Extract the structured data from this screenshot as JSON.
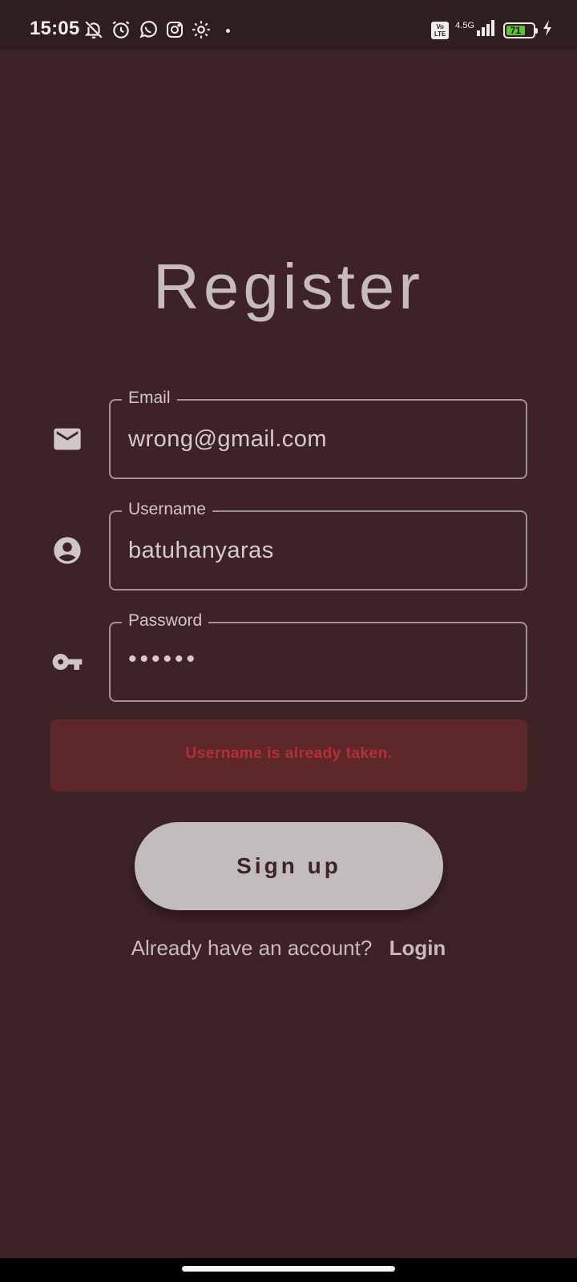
{
  "status_bar": {
    "time": "15:05",
    "network": "4.5G",
    "volte": "Vo LTE",
    "battery": "71"
  },
  "title": "Register",
  "fields": {
    "email": {
      "label": "Email",
      "value": "wrong@gmail.com"
    },
    "username": {
      "label": "Username",
      "value": "batuhanyaras"
    },
    "password": {
      "label": "Password",
      "value": "••••••"
    }
  },
  "error": {
    "message": "Username is already taken."
  },
  "signup_button": {
    "label": "Sign up"
  },
  "login": {
    "prompt": "Already have an account?",
    "link": "Login"
  },
  "colors": {
    "background": "#3e2326",
    "status_bar": "#2f1e20",
    "error_bg": "#5e282b",
    "error_text": "#b33033",
    "button_bg": "#c2bcbd"
  }
}
